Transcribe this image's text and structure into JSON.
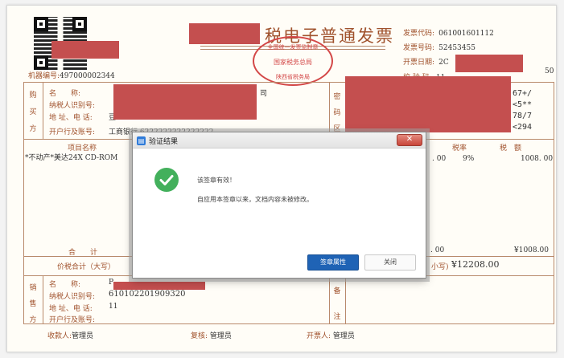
{
  "invoice": {
    "title_visible": "税电子普通发票",
    "machine_no_label": "机器编号:",
    "machine_no": "497000002344",
    "code_label": "发票代码:",
    "code": "061001601112",
    "number_label": "发票号码:",
    "number": "52453455",
    "date_label": "开票日期:",
    "date_partial": "2C",
    "check_label": "校 验 码:",
    "check_partial": "11",
    "check_tail": "50",
    "seal_top": "全国统一发票监制章",
    "seal_mid": "国家税务总局",
    "seal_bottom": "陕西省税务局",
    "buyer_side": [
      "购",
      "买",
      "方"
    ],
    "buyer_fields": [
      "名　　称:",
      "纳税人识别号:",
      "地 址、电 话:",
      "开户行及账号:"
    ],
    "buyer_name_tail": "司",
    "buyer_bank_partial": "工商银行 6222222222222222",
    "buyer_addr_head": "豆",
    "password_side": [
      "密",
      "码",
      "区"
    ],
    "password_lines": [
      "67+/",
      "<5**",
      "78/7",
      "<294"
    ],
    "item_header": "项目名称",
    "rate_header": "税率",
    "tax_header": "税　额",
    "item_name": "*不动产*美达24X CD-ROM",
    "item_amount_partial": ". 00",
    "item_rate": "9%",
    "item_tax": "1008. 00",
    "total_label": "合　　计",
    "total_amount_partial": ". 00",
    "total_tax": "¥1008.00",
    "grand_label": "价税合计（大写）",
    "grand_small_label": "小写)",
    "grand_small_value": "¥12208.00",
    "seller_side": [
      "销",
      "售",
      "方"
    ],
    "seller_fields": [
      "名　　称:",
      "纳税人识别号:",
      "地 址、电 话:",
      "开户行及账号:"
    ],
    "seller_name_head": "P",
    "seller_taxid_partial": "610102201909320",
    "seller_phone": "11",
    "remarks_side": [
      "备",
      "注"
    ],
    "payee_label": "收款人:",
    "payee": "管理员",
    "reviewer_label": "复核:",
    "reviewer": "管理员",
    "issuer_label": "开票人:",
    "issuer": "管理员"
  },
  "dialog": {
    "title": "验证结果",
    "close_glyph": "✕",
    "message_1": "该签章有效！",
    "message_2": "自应用本签章以来，文档内容未被修改。",
    "primary_button": "签章属性",
    "secondary_button": "关闭"
  },
  "colors": {
    "redaction": "#c44f4f",
    "ink": "#a0522d",
    "seal": "#d34747",
    "primary_button": "#1f63b5",
    "check": "#43b05c"
  }
}
